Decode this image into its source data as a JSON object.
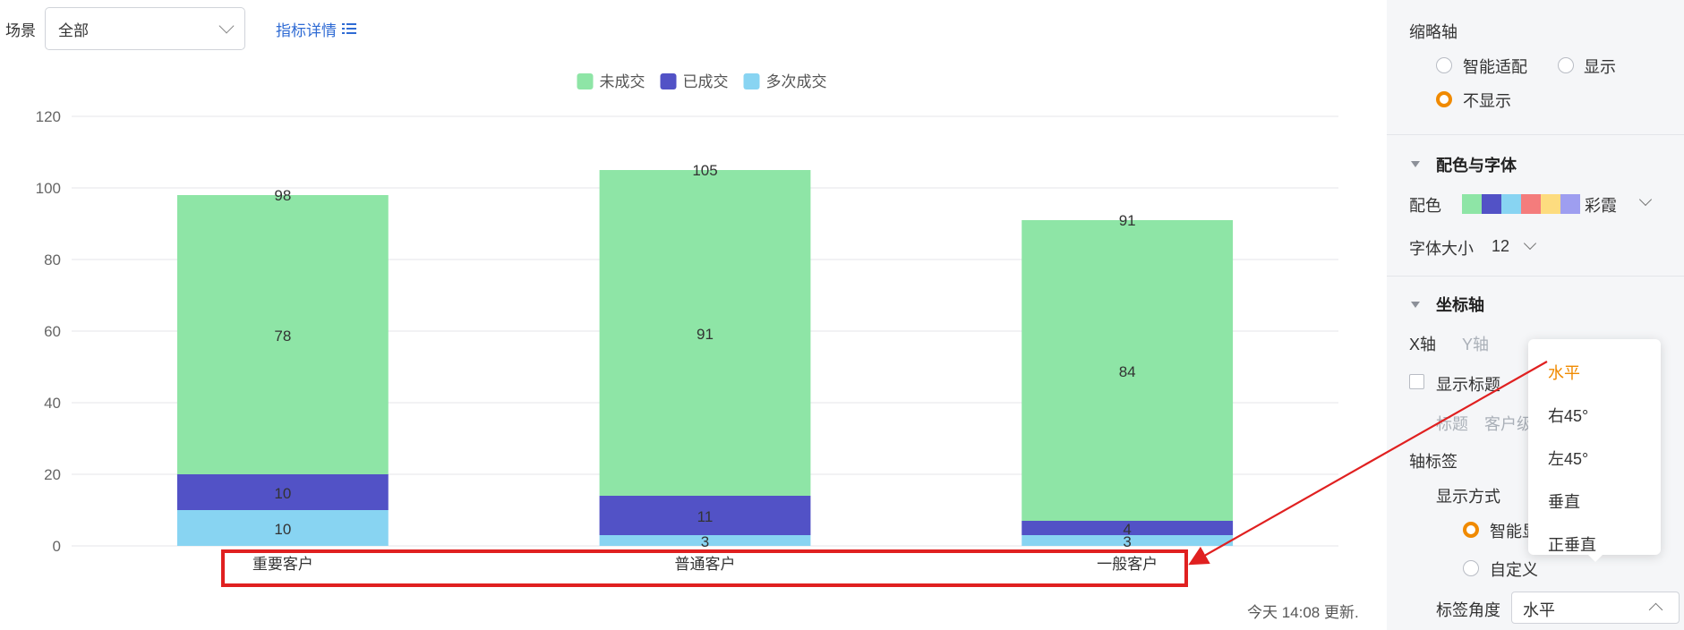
{
  "toolbar": {
    "scene_label": "场景",
    "scene_value": "全部",
    "detail_link": "指标详情"
  },
  "chart_data": {
    "type": "bar",
    "stacked": true,
    "categories": [
      "重要客户",
      "普通客户",
      "一般客户"
    ],
    "series": [
      {
        "name": "多次成交",
        "color": "#88d4f2",
        "values": [
          10,
          3,
          3
        ]
      },
      {
        "name": "已成交",
        "color": "#5252c6",
        "values": [
          10,
          11,
          4
        ]
      },
      {
        "name": "未成交",
        "color": "#8ee5a6",
        "values": [
          78,
          91,
          84
        ]
      }
    ],
    "totals": [
      98,
      105,
      91
    ],
    "y_ticks": [
      0,
      20,
      40,
      60,
      80,
      100,
      120
    ],
    "ylim": [
      0,
      120
    ],
    "grid": true,
    "legend_position": "top-center",
    "legend_order": [
      "未成交",
      "已成交",
      "多次成交"
    ],
    "grid_color": "#e5e6ea",
    "label_color": "#333333",
    "tick_color": "#666666"
  },
  "update_note": "今天 14:08 更新.",
  "panel": {
    "thumb_axis": {
      "title": "缩略轴",
      "options": [
        {
          "label": "智能适配",
          "selected": false
        },
        {
          "label": "显示",
          "selected": false
        },
        {
          "label": "不显示",
          "selected": true
        }
      ]
    },
    "color_font": {
      "title": "配色与字体",
      "color_label": "配色",
      "swatch_colors": [
        "#8ee5a6",
        "#5252c6",
        "#88d4f2",
        "#f47c7c",
        "#fddc7f",
        "#9e9ef0"
      ],
      "palette_name": "彩霞",
      "font_size_label": "字体大小",
      "font_size_value": "12"
    },
    "axis": {
      "title": "坐标轴",
      "tab_x": "X轴",
      "tab_y": "Y轴",
      "show_title_label": "显示标题",
      "title_placeholder": "标题",
      "title_value": "客户级",
      "axis_label_title": "轴标签",
      "display_mode_label": "显示方式",
      "display_mode_options": [
        "智能显",
        "自定义"
      ],
      "angle_label": "标签角度",
      "angle_value": "水平"
    }
  },
  "angle_menu": {
    "items": [
      {
        "label": "水平",
        "active": true
      },
      {
        "label": "右45°",
        "active": false
      },
      {
        "label": "左45°",
        "active": false
      },
      {
        "label": "垂直",
        "active": false
      },
      {
        "label": "正垂直",
        "active": false
      }
    ]
  },
  "accent_color": "#f08a00",
  "link_color": "#2f6bd4",
  "annotation_color": "#e02020"
}
